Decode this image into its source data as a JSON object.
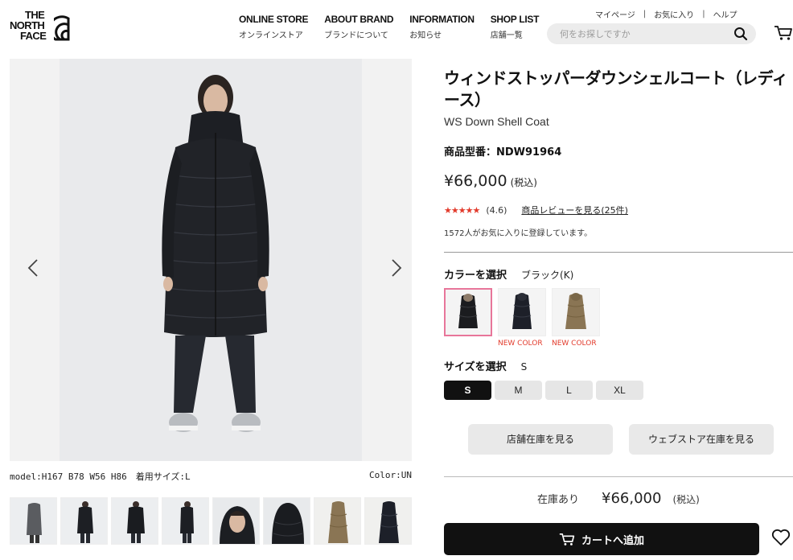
{
  "brand": {
    "logo_lines": [
      "THE",
      "NORTH",
      "FACE"
    ],
    "logo_mark": "®"
  },
  "nav": [
    {
      "en": "ONLINE STORE",
      "jp": "オンラインストア"
    },
    {
      "en": "ABOUT BRAND",
      "jp": "ブランドについて"
    },
    {
      "en": "INFORMATION",
      "jp": "お知らせ"
    },
    {
      "en": "SHOP LIST",
      "jp": "店舗一覧"
    }
  ],
  "util": {
    "mypage": "マイページ",
    "favorites": "お気に入り",
    "help": "ヘルプ",
    "separator": "|"
  },
  "search": {
    "placeholder": "何をお探しですか",
    "icon": "search-icon"
  },
  "gallery": {
    "model_info": "model:H167 B78 W56 H86　着用サイズ:L",
    "color_info": "Color:UN",
    "thumb_count": 8
  },
  "product": {
    "title": "ウィンドストッパーダウンシェルコート（レディース）",
    "subtitle": "WS Down Shell Coat",
    "model_no": "商品型番：NDW91964",
    "price": "¥66,000",
    "tax": "(税込)",
    "stars": "★★★★★",
    "rating_fraction": 0.92,
    "score": "(4.6)",
    "review_link": "商品レビューを見る(25件)",
    "fav_count": "1572人がお気に入りに登録しています。"
  },
  "color": {
    "label": "カラーを選択",
    "selected": "ブラック(K)",
    "swatches": [
      {
        "name": "black-unisex",
        "new": ""
      },
      {
        "name": "black-navy",
        "new": "NEW COLOR"
      },
      {
        "name": "khaki",
        "new": "NEW COLOR"
      }
    ]
  },
  "size": {
    "label": "サイズを選択",
    "selected": "S",
    "options": [
      "S",
      "M",
      "L",
      "XL"
    ]
  },
  "stock": {
    "store_btn": "店舗在庫を見る",
    "web_btn": "ウェブストア在庫を見る",
    "availability": "在庫あり",
    "price": "¥66,000",
    "tax": "(税込)"
  },
  "cart": {
    "add_label": "カートへ追加"
  },
  "colors": {
    "accent_red": "#e23a2b",
    "swatch_border": "#e8769a",
    "button_dark": "#111111"
  }
}
